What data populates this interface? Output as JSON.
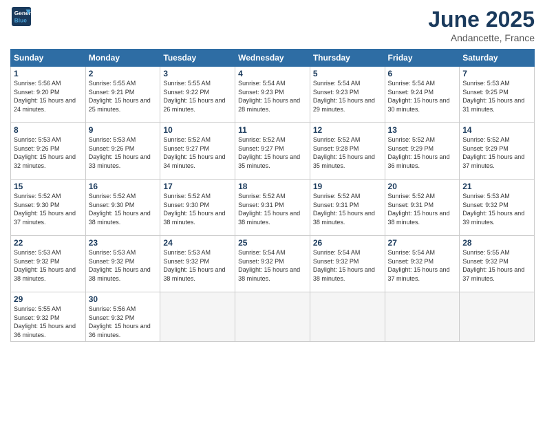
{
  "logo": {
    "line1": "General",
    "line2": "Blue"
  },
  "title": "June 2025",
  "location": "Andancette, France",
  "weekdays": [
    "Sunday",
    "Monday",
    "Tuesday",
    "Wednesday",
    "Thursday",
    "Friday",
    "Saturday"
  ],
  "weeks": [
    [
      {
        "day": "1",
        "sunrise": "Sunrise: 5:56 AM",
        "sunset": "Sunset: 9:20 PM",
        "daylight": "Daylight: 15 hours and 24 minutes."
      },
      {
        "day": "2",
        "sunrise": "Sunrise: 5:55 AM",
        "sunset": "Sunset: 9:21 PM",
        "daylight": "Daylight: 15 hours and 25 minutes."
      },
      {
        "day": "3",
        "sunrise": "Sunrise: 5:55 AM",
        "sunset": "Sunset: 9:22 PM",
        "daylight": "Daylight: 15 hours and 26 minutes."
      },
      {
        "day": "4",
        "sunrise": "Sunrise: 5:54 AM",
        "sunset": "Sunset: 9:23 PM",
        "daylight": "Daylight: 15 hours and 28 minutes."
      },
      {
        "day": "5",
        "sunrise": "Sunrise: 5:54 AM",
        "sunset": "Sunset: 9:23 PM",
        "daylight": "Daylight: 15 hours and 29 minutes."
      },
      {
        "day": "6",
        "sunrise": "Sunrise: 5:54 AM",
        "sunset": "Sunset: 9:24 PM",
        "daylight": "Daylight: 15 hours and 30 minutes."
      },
      {
        "day": "7",
        "sunrise": "Sunrise: 5:53 AM",
        "sunset": "Sunset: 9:25 PM",
        "daylight": "Daylight: 15 hours and 31 minutes."
      }
    ],
    [
      {
        "day": "8",
        "sunrise": "Sunrise: 5:53 AM",
        "sunset": "Sunset: 9:26 PM",
        "daylight": "Daylight: 15 hours and 32 minutes."
      },
      {
        "day": "9",
        "sunrise": "Sunrise: 5:53 AM",
        "sunset": "Sunset: 9:26 PM",
        "daylight": "Daylight: 15 hours and 33 minutes."
      },
      {
        "day": "10",
        "sunrise": "Sunrise: 5:52 AM",
        "sunset": "Sunset: 9:27 PM",
        "daylight": "Daylight: 15 hours and 34 minutes."
      },
      {
        "day": "11",
        "sunrise": "Sunrise: 5:52 AM",
        "sunset": "Sunset: 9:27 PM",
        "daylight": "Daylight: 15 hours and 35 minutes."
      },
      {
        "day": "12",
        "sunrise": "Sunrise: 5:52 AM",
        "sunset": "Sunset: 9:28 PM",
        "daylight": "Daylight: 15 hours and 35 minutes."
      },
      {
        "day": "13",
        "sunrise": "Sunrise: 5:52 AM",
        "sunset": "Sunset: 9:29 PM",
        "daylight": "Daylight: 15 hours and 36 minutes."
      },
      {
        "day": "14",
        "sunrise": "Sunrise: 5:52 AM",
        "sunset": "Sunset: 9:29 PM",
        "daylight": "Daylight: 15 hours and 37 minutes."
      }
    ],
    [
      {
        "day": "15",
        "sunrise": "Sunrise: 5:52 AM",
        "sunset": "Sunset: 9:30 PM",
        "daylight": "Daylight: 15 hours and 37 minutes."
      },
      {
        "day": "16",
        "sunrise": "Sunrise: 5:52 AM",
        "sunset": "Sunset: 9:30 PM",
        "daylight": "Daylight: 15 hours and 38 minutes."
      },
      {
        "day": "17",
        "sunrise": "Sunrise: 5:52 AM",
        "sunset": "Sunset: 9:30 PM",
        "daylight": "Daylight: 15 hours and 38 minutes."
      },
      {
        "day": "18",
        "sunrise": "Sunrise: 5:52 AM",
        "sunset": "Sunset: 9:31 PM",
        "daylight": "Daylight: 15 hours and 38 minutes."
      },
      {
        "day": "19",
        "sunrise": "Sunrise: 5:52 AM",
        "sunset": "Sunset: 9:31 PM",
        "daylight": "Daylight: 15 hours and 38 minutes."
      },
      {
        "day": "20",
        "sunrise": "Sunrise: 5:52 AM",
        "sunset": "Sunset: 9:31 PM",
        "daylight": "Daylight: 15 hours and 38 minutes."
      },
      {
        "day": "21",
        "sunrise": "Sunrise: 5:53 AM",
        "sunset": "Sunset: 9:32 PM",
        "daylight": "Daylight: 15 hours and 39 minutes."
      }
    ],
    [
      {
        "day": "22",
        "sunrise": "Sunrise: 5:53 AM",
        "sunset": "Sunset: 9:32 PM",
        "daylight": "Daylight: 15 hours and 38 minutes."
      },
      {
        "day": "23",
        "sunrise": "Sunrise: 5:53 AM",
        "sunset": "Sunset: 9:32 PM",
        "daylight": "Daylight: 15 hours and 38 minutes."
      },
      {
        "day": "24",
        "sunrise": "Sunrise: 5:53 AM",
        "sunset": "Sunset: 9:32 PM",
        "daylight": "Daylight: 15 hours and 38 minutes."
      },
      {
        "day": "25",
        "sunrise": "Sunrise: 5:54 AM",
        "sunset": "Sunset: 9:32 PM",
        "daylight": "Daylight: 15 hours and 38 minutes."
      },
      {
        "day": "26",
        "sunrise": "Sunrise: 5:54 AM",
        "sunset": "Sunset: 9:32 PM",
        "daylight": "Daylight: 15 hours and 38 minutes."
      },
      {
        "day": "27",
        "sunrise": "Sunrise: 5:54 AM",
        "sunset": "Sunset: 9:32 PM",
        "daylight": "Daylight: 15 hours and 37 minutes."
      },
      {
        "day": "28",
        "sunrise": "Sunrise: 5:55 AM",
        "sunset": "Sunset: 9:32 PM",
        "daylight": "Daylight: 15 hours and 37 minutes."
      }
    ],
    [
      {
        "day": "29",
        "sunrise": "Sunrise: 5:55 AM",
        "sunset": "Sunset: 9:32 PM",
        "daylight": "Daylight: 15 hours and 36 minutes."
      },
      {
        "day": "30",
        "sunrise": "Sunrise: 5:56 AM",
        "sunset": "Sunset: 9:32 PM",
        "daylight": "Daylight: 15 hours and 36 minutes."
      },
      null,
      null,
      null,
      null,
      null
    ]
  ]
}
